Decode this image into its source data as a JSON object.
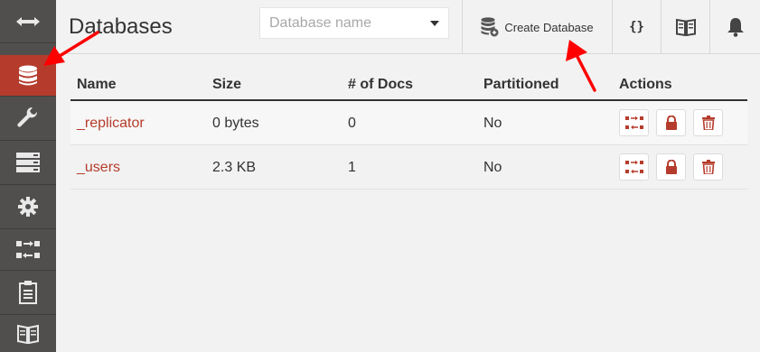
{
  "sidebar": {
    "items": [
      {
        "name": "toggle-menu",
        "icon": "double-arrow-icon",
        "active": false
      },
      {
        "name": "databases",
        "icon": "database-icon",
        "active": true
      },
      {
        "name": "setup",
        "icon": "wrench-icon",
        "active": false
      },
      {
        "name": "active-tasks",
        "icon": "server-stack-icon",
        "active": false
      },
      {
        "name": "config",
        "icon": "gear-icon",
        "active": false
      },
      {
        "name": "replication",
        "icon": "replication-icon",
        "active": false
      },
      {
        "name": "logs",
        "icon": "clipboard-icon",
        "active": false
      },
      {
        "name": "documentation",
        "icon": "book-icon",
        "active": false
      }
    ],
    "active_color": "#b53c2c",
    "background": "#514f4e"
  },
  "header": {
    "title": "Databases",
    "search_placeholder": "Database name",
    "create_label": "Create Database",
    "json_label": "{}"
  },
  "table": {
    "columns": [
      "Name",
      "Size",
      "# of Docs",
      "Partitioned",
      "Actions"
    ],
    "rows": [
      {
        "name": "_replicator",
        "size": "0 bytes",
        "docs": "0",
        "partitioned": "No"
      },
      {
        "name": "_users",
        "size": "2.3 KB",
        "docs": "1",
        "partitioned": "No"
      }
    ]
  },
  "accent_color": "#b53c2c",
  "annotation_color": "#ff0000"
}
